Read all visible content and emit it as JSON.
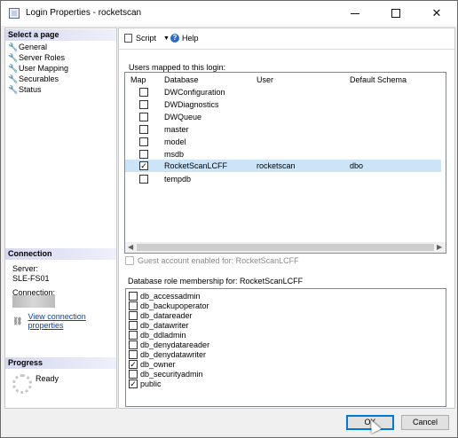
{
  "window": {
    "title": "Login Properties - rocketscan"
  },
  "left": {
    "select_page_header": "Select a page",
    "pages": [
      "General",
      "Server Roles",
      "User Mapping",
      "Securables",
      "Status"
    ],
    "connection_header": "Connection",
    "server_label": "Server:",
    "server_value": "SLE-FS01",
    "connection_label": "Connection:",
    "view_conn_link": "View connection properties",
    "progress_header": "Progress",
    "progress_status": "Ready"
  },
  "toolbar": {
    "script_label": "Script",
    "help_label": "Help"
  },
  "mapping": {
    "label": "Users mapped to this login:",
    "headers": {
      "map": "Map",
      "database": "Database",
      "user": "User",
      "schema": "Default Schema"
    },
    "rows": [
      {
        "db": "DWConfiguration",
        "user": "",
        "schema": "",
        "checked": false
      },
      {
        "db": "DWDiagnostics",
        "user": "",
        "schema": "",
        "checked": false
      },
      {
        "db": "DWQueue",
        "user": "",
        "schema": "",
        "checked": false
      },
      {
        "db": "master",
        "user": "",
        "schema": "",
        "checked": false
      },
      {
        "db": "model",
        "user": "",
        "schema": "",
        "checked": false
      },
      {
        "db": "msdb",
        "user": "",
        "schema": "",
        "checked": false
      },
      {
        "db": "RocketScanLCFF",
        "user": "rocketscan",
        "schema": "dbo",
        "checked": true
      },
      {
        "db": "tempdb",
        "user": "",
        "schema": "",
        "checked": false
      }
    ]
  },
  "guest_label": "Guest account enabled for: RocketScanLCFF",
  "roles": {
    "label": "Database role membership for: RocketScanLCFF",
    "items": [
      {
        "name": "db_accessadmin",
        "checked": false
      },
      {
        "name": "db_backupoperator",
        "checked": false
      },
      {
        "name": "db_datareader",
        "checked": false
      },
      {
        "name": "db_datawriter",
        "checked": false
      },
      {
        "name": "db_ddladmin",
        "checked": false
      },
      {
        "name": "db_denydatareader",
        "checked": false
      },
      {
        "name": "db_denydatawriter",
        "checked": false
      },
      {
        "name": "db_owner",
        "checked": true
      },
      {
        "name": "db_securityadmin",
        "checked": false
      },
      {
        "name": "public",
        "checked": true
      }
    ]
  },
  "buttons": {
    "ok": "OK",
    "cancel": "Cancel"
  }
}
